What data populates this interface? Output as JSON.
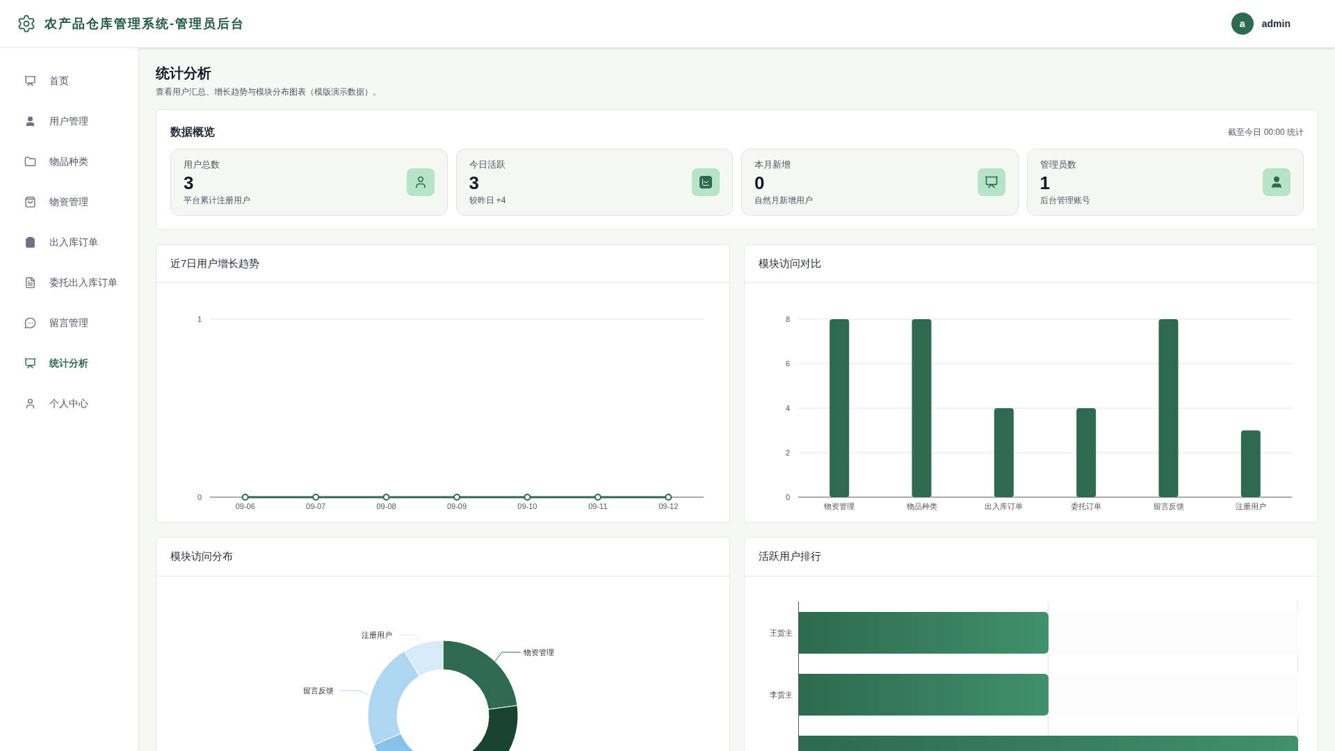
{
  "header": {
    "title": "农产品仓库管理系统-管理员后台",
    "avatar_letter": "a",
    "username": "admin"
  },
  "sidebar": {
    "items": [
      {
        "label": "首页",
        "selected": false
      },
      {
        "label": "用户管理",
        "selected": false
      },
      {
        "label": "物品种类",
        "selected": false
      },
      {
        "label": "物资管理",
        "selected": false
      },
      {
        "label": "出入库订单",
        "selected": false
      },
      {
        "label": "委托出入库订单",
        "selected": false
      },
      {
        "label": "留言管理",
        "selected": false
      },
      {
        "label": "统计分析",
        "selected": true
      },
      {
        "label": "个人中心",
        "selected": false
      }
    ]
  },
  "page": {
    "title": "统计分析",
    "subtitle": "查看用户汇总、增长趋势与模块分布图表（模版演示数据）。"
  },
  "overview": {
    "title": "数据概览",
    "note": "截至今日 00:00 统计",
    "cards": [
      {
        "label": "用户总数",
        "value": "3",
        "hint": "平台累计注册用户"
      },
      {
        "label": "今日活跃",
        "value": "3",
        "hint": "较昨日 +4"
      },
      {
        "label": "本月新增",
        "value": "0",
        "hint": "自然月新增用户"
      },
      {
        "label": "管理员数",
        "value": "1",
        "hint": "后台管理账号"
      }
    ]
  },
  "growth": {
    "title": "近7日用户增长趋势",
    "chart_data": {
      "type": "line",
      "categories": [
        "09-06",
        "09-07",
        "09-08",
        "09-09",
        "09-10",
        "09-11",
        "09-12"
      ],
      "series": [
        {
          "color": "#2d6a4f",
          "marker": true,
          "values": [
            0,
            0,
            0,
            0,
            0,
            0,
            0
          ]
        }
      ],
      "ylim": [
        0,
        1
      ],
      "yticks": [
        0,
        1
      ],
      "grid": true
    }
  },
  "module_compare": {
    "title": "模块访问对比",
    "chart_data": {
      "type": "bar",
      "categories": [
        "物资管理",
        "物品种类",
        "出入库订单",
        "委托订单",
        "留言反馈",
        "注册用户"
      ],
      "series": [
        {
          "color": "#2d6a4f",
          "values": [
            8,
            8,
            4,
            4,
            8,
            3
          ]
        }
      ],
      "ylim": [
        0,
        8
      ],
      "yticks": [
        0,
        2,
        4,
        6,
        8
      ],
      "grid": true
    }
  },
  "module_share": {
    "title": "模块访问分布",
    "labels": [
      "注册用户",
      "物资管理",
      "留言反馈"
    ]
  },
  "active_users": {
    "title": "活跃用户排行",
    "rows": [
      {
        "name": "王货主",
        "level": 0.5
      },
      {
        "name": "李货主",
        "level": 0.5
      },
      {
        "level": 1
      }
    ]
  }
}
